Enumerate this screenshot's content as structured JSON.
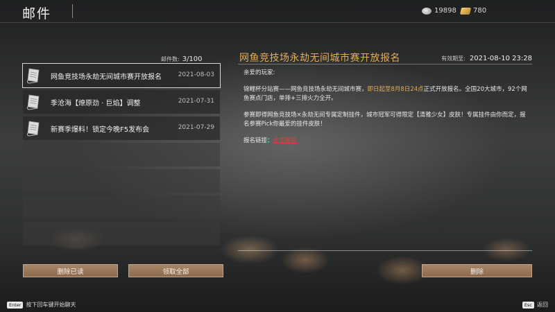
{
  "header": {
    "title": "邮件",
    "silver_amount": "19898",
    "gold_amount": "780",
    "silver_icon": "silver-coin-icon",
    "gold_icon": "gold-bar-icon"
  },
  "mail_list": {
    "count_label": "邮件数:",
    "count_value": "3/100",
    "items": [
      {
        "subject": "网鱼竞技场永劫无间城市赛开放报名",
        "date": "2021-08-03",
        "selected": true,
        "icon": "scroll-mail-icon"
      },
      {
        "subject": "季沧海【燎原劲 · 巨焰】调整",
        "date": "2021-07-31",
        "selected": false,
        "icon": "scroll-mail-icon"
      },
      {
        "subject": "新赛季爆料！锁定今晚F5发布会",
        "date": "2021-07-29",
        "selected": false,
        "icon": "scroll-mail-icon"
      }
    ],
    "empty_slots": 4
  },
  "buttons": {
    "delete_read": "删除已读",
    "collect_all": "领取全部",
    "delete": "删除"
  },
  "detail": {
    "title": "网鱼竞技场永劫无间城市赛开放报名",
    "expiry_label": "有效期至:",
    "expiry_value": "2021-08-10 23:28",
    "greeting": "亲爱的玩家:",
    "para1_a": "锦鲤杯分站赛——网鱼竞技场永劫无间城市赛，",
    "para1_highlight": "即日起至8月8日24点",
    "para1_b": "正式开放报名。全国20大城市，92个网鱼赛点门店，单排+三排火力全开。",
    "para2": "参赛即得网鱼竞技场×永劫无间专属定制挂件，城市冠军可得限定【清雅少女】皮肤！专属挂件由你而定，报名参赛Pick你最爱的挂件皮肤！",
    "link_label": "报名链接：",
    "link_text": "点击报名",
    "highlight_color": "#e3ad5a",
    "link_color": "#d8423d"
  },
  "footer": {
    "enter_key": "Enter",
    "enter_hint": "按下回车键开始聊天",
    "esc_key": "Esc",
    "esc_hint": "返回"
  }
}
